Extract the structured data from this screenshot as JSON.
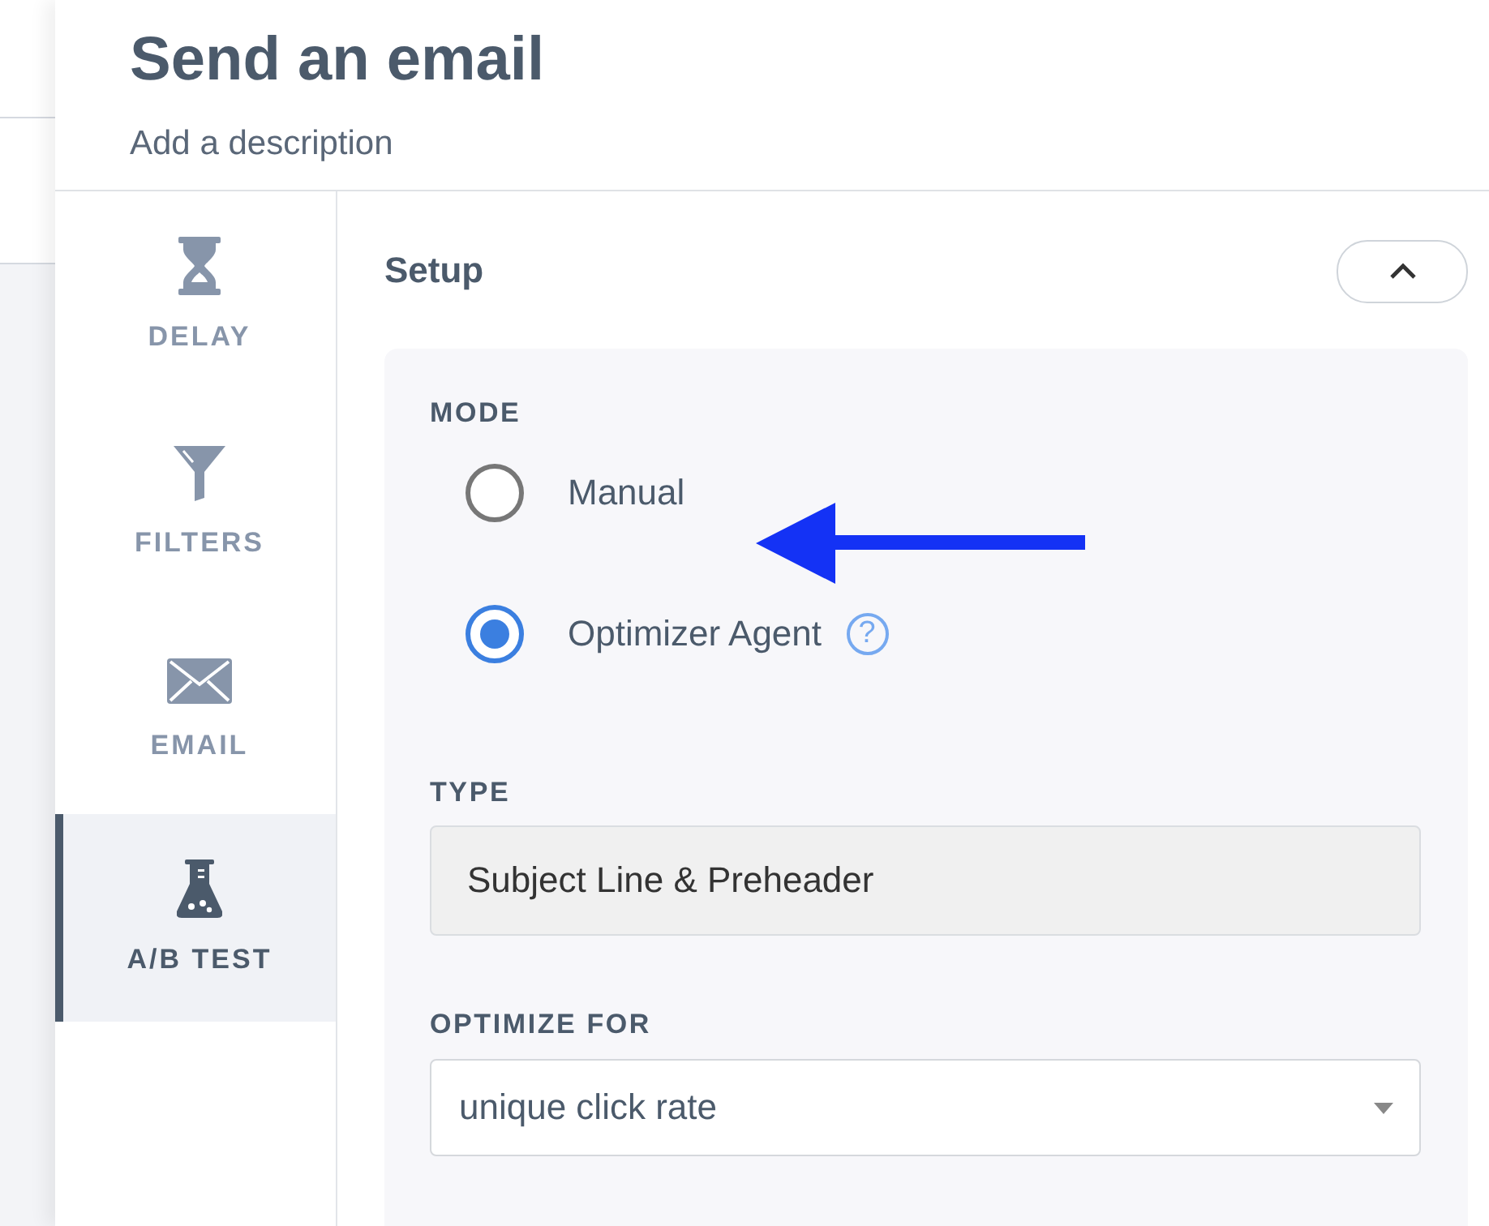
{
  "header": {
    "title": "Send an email",
    "description": "Add a description"
  },
  "sidebar": {
    "items": [
      {
        "kind": "delay",
        "label": "DELAY",
        "selected": false
      },
      {
        "kind": "filter",
        "label": "FILTERS",
        "selected": false
      },
      {
        "kind": "email",
        "label": "EMAIL",
        "selected": false
      },
      {
        "kind": "test",
        "label": "A/B TEST",
        "selected": true
      }
    ]
  },
  "setup": {
    "title": "Setup",
    "expanded": true,
    "mode": {
      "label": "MODE",
      "options": [
        {
          "label": "Manual",
          "selected": false
        },
        {
          "label": "Optimizer Agent",
          "selected": true,
          "help": "?"
        }
      ]
    },
    "type": {
      "label": "TYPE",
      "value": "Subject Line & Preheader"
    },
    "optimize_for": {
      "label": "OPTIMIZE FOR",
      "value": "unique click rate"
    }
  },
  "annotations": [
    {
      "kind": "arrow"
    }
  ]
}
